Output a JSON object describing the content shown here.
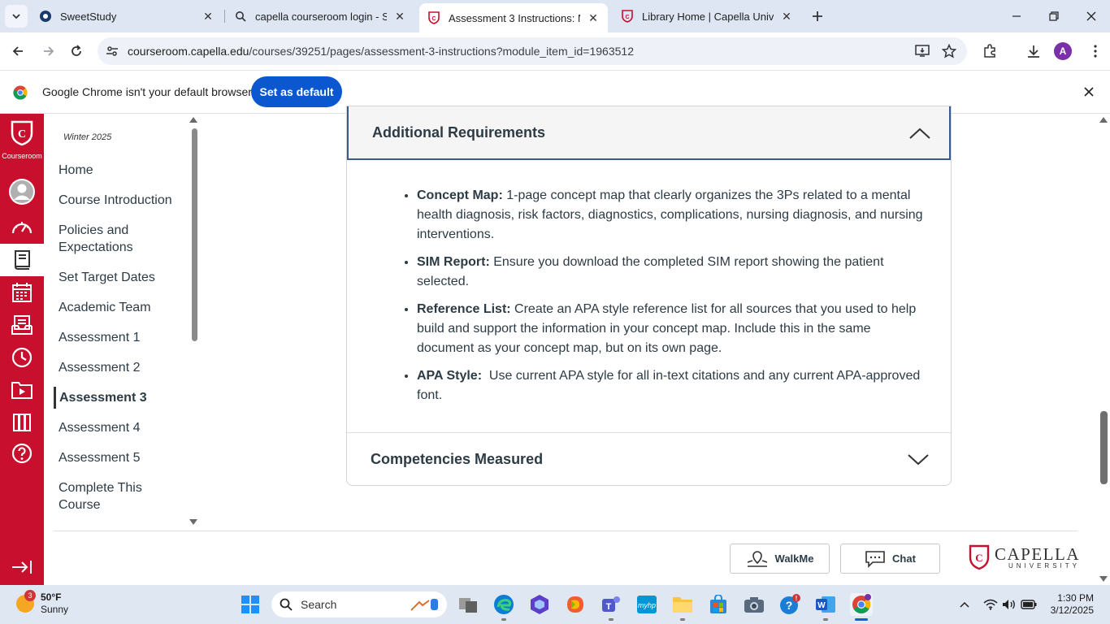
{
  "browser": {
    "tabs": [
      {
        "title": "SweetStudy",
        "active": false
      },
      {
        "title": "capella courseroom login - Sea",
        "active": false
      },
      {
        "title": "Assessment 3 Instructions: NUR",
        "active": true
      },
      {
        "title": "Library Home | Capella Universi",
        "active": false
      }
    ],
    "url_host": "courseroom.capella.edu",
    "url_path": "/courses/39251/pages/assessment-3-instructions?module_item_id=1963512",
    "profile_initial": "A"
  },
  "infobar": {
    "message": "Google Chrome isn't your default browser",
    "button": "Set as default"
  },
  "rail": {
    "brand_label": "Courseroom"
  },
  "coursenav": {
    "term": "Winter 2025",
    "items": [
      {
        "label": "Home"
      },
      {
        "label": "Course Introduction"
      },
      {
        "label": "Policies and Expectations"
      },
      {
        "label": "Set Target Dates"
      },
      {
        "label": "Academic Team"
      },
      {
        "label": "Assessment 1"
      },
      {
        "label": "Assessment 2"
      },
      {
        "label": "Assessment 3"
      },
      {
        "label": "Assessment 4"
      },
      {
        "label": "Assessment 5"
      },
      {
        "label": "Complete This Course"
      }
    ],
    "active_index": 7
  },
  "content": {
    "section1_title": "Additional Requirements",
    "requirements": [
      {
        "term": "Concept Map:",
        "text": " 1-page concept map that clearly organizes the 3Ps related to a mental health diagnosis, risk factors, diagnostics, complications, nursing diagnosis, and nursing interventions."
      },
      {
        "term": "SIM Report:",
        "text": " Ensure you download the completed SIM report showing the patient selected."
      },
      {
        "term": "Reference List:",
        "text": " Create an APA style reference list for all sources that you used to help build and support the information in your concept map. Include this in the same document as your concept map, but on its own page."
      },
      {
        "term": "APA Style:",
        "text": "  Use current APA style for all in-text citations and any current APA-approved font."
      }
    ],
    "section2_title": "Competencies Measured"
  },
  "footer": {
    "walkme": "WalkMe",
    "chat": "Chat",
    "logo_word": "CAPELLA",
    "logo_sub": "UNIVERSITY"
  },
  "taskbar": {
    "weather_badge": "3",
    "temperature": "50°F",
    "condition": "Sunny",
    "search_label": "Search",
    "time": "1:30 PM",
    "date": "3/12/2025"
  },
  "colors": {
    "brand_red": "#c8102e",
    "chrome_blue": "#0b57d0",
    "text": "#2d3b45"
  }
}
